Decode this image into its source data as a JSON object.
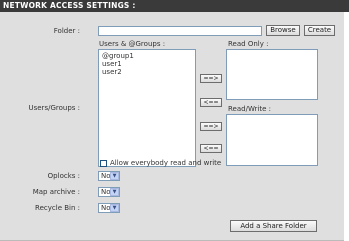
{
  "header": {
    "title": "NETWORK ACCESS SETTINGS :"
  },
  "folder": {
    "label": "Folder :",
    "value": "",
    "browse_label": "Browse",
    "create_label": "Create"
  },
  "users_groups": {
    "row_label": "Users/Groups :",
    "list_title": "Users & @Groups :",
    "items": [
      "@group1",
      "user1",
      "user2"
    ]
  },
  "read_only": {
    "title": "Read Only :",
    "add_label": "==>",
    "remove_label": "<=="
  },
  "read_write": {
    "title": "Read/Write :",
    "add_label": "==>",
    "remove_label": "<=="
  },
  "allow_everybody": {
    "label": "Allow everybody read and write",
    "checked": false
  },
  "oplocks": {
    "label": "Oplocks :",
    "value": "No"
  },
  "map_archive": {
    "label": "Map archive :",
    "value": "No"
  },
  "recycle_bin": {
    "label": "Recycle Bin :",
    "value": "No"
  },
  "add_share": {
    "label": "Add a Share Folder"
  },
  "icons": {
    "dropdown": "chevron-down-icon"
  }
}
